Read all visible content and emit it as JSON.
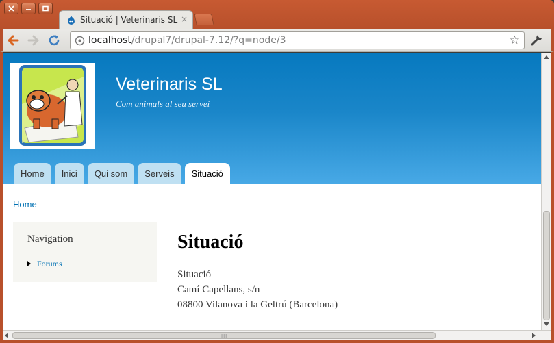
{
  "browser": {
    "tab_title": "Situació | Veterinaris SL",
    "tab_close": "×",
    "url_host": "localhost",
    "url_path": "/drupal7/drupal-7.12/?q=node/3",
    "bookmark_star": "☆",
    "accent_color": "#b8502b"
  },
  "site": {
    "name": "Veterinaris SL",
    "slogan": "Com animals al seu servei",
    "logo_icon": "vet-bulldog-logo-icon"
  },
  "menu": {
    "items": [
      "Home",
      "Inici",
      "Qui som",
      "Serveis",
      "Situació"
    ],
    "active": "Situació"
  },
  "breadcrumb": "Home",
  "sidebar": {
    "title": "Navigation",
    "items": [
      "Forums"
    ]
  },
  "node": {
    "title": "Situació",
    "body": [
      "Situació",
      "Camí Capellans, s/n",
      "08800 Vilanova i la Geltrú (Barcelona)"
    ]
  },
  "scroll": {
    "grip": "III"
  }
}
